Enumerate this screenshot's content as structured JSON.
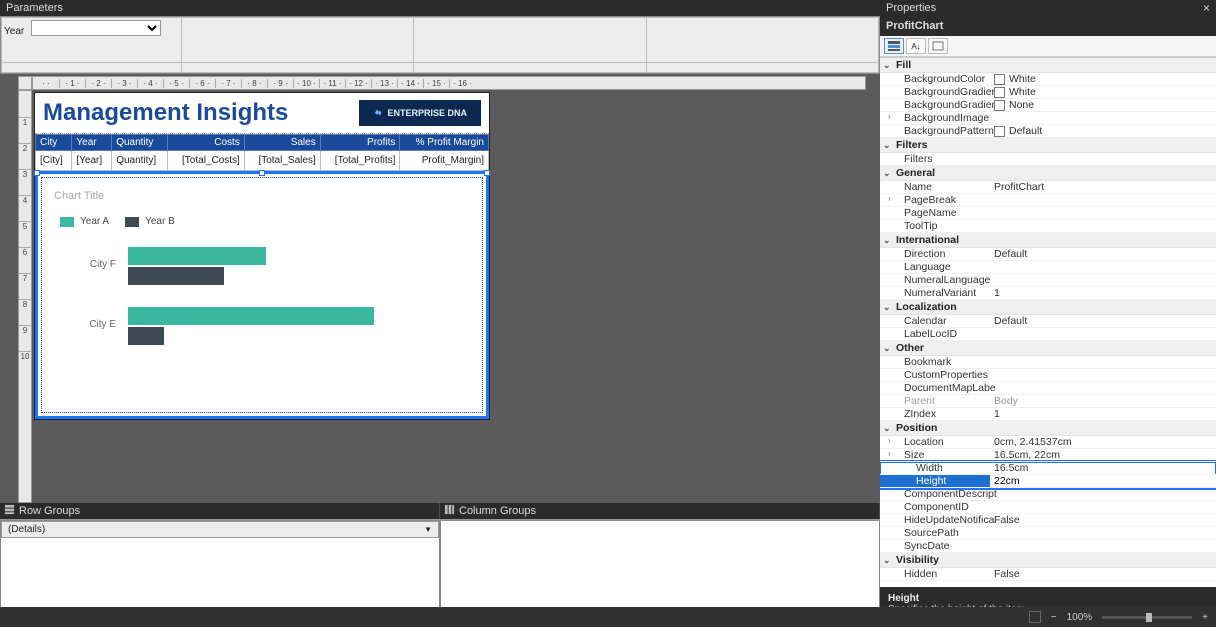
{
  "panels": {
    "parameters_title": "Parameters",
    "properties_title": "Properties",
    "row_groups_title": "Row Groups",
    "column_groups_title": "Column Groups",
    "details_label": "(Details)"
  },
  "params": {
    "year_label": "Year",
    "year_value": ""
  },
  "ruler_h": [
    "",
    "1",
    "2",
    "3",
    "4",
    "5",
    "6",
    "7",
    "8",
    "9",
    "10",
    "11",
    "12",
    "13",
    "14",
    "15",
    "16"
  ],
  "ruler_v": [
    "",
    "1",
    "2",
    "3",
    "4",
    "5",
    "6",
    "7",
    "8",
    "9",
    "10"
  ],
  "report": {
    "title": "Management Insights",
    "logo_text": "ENTERPRISE DNA",
    "columns": [
      "City",
      "Year",
      "Quantity",
      "Costs",
      "Sales",
      "Profits",
      "% Profit Margin"
    ],
    "cells": [
      "[City]",
      "[Year]",
      "Quantity]",
      "[Total_Costs]",
      "[Total_Sales]",
      "[Total_Profits]",
      "Profit_Margin]"
    ]
  },
  "chart": {
    "placeholder_title": "Chart Title",
    "legend_a": "Year A",
    "legend_b": "Year B"
  },
  "chart_data": {
    "type": "bar",
    "orientation": "horizontal",
    "categories": [
      "City F",
      "City E"
    ],
    "series": [
      {
        "name": "Year A",
        "color": "#3ab6a1",
        "values": [
          46,
          82
        ]
      },
      {
        "name": "Year B",
        "color": "#3e4954",
        "values": [
          32,
          12
        ]
      }
    ],
    "title": "Chart Title",
    "xlim": [
      0,
      100
    ]
  },
  "properties": {
    "selected_object": "ProfitChart",
    "groups": [
      {
        "name": "Fill",
        "expanded": true,
        "items": [
          {
            "k": "BackgroundColor",
            "v": "White",
            "color": "#ffffff"
          },
          {
            "k": "BackgroundGradientEndColor",
            "display_k": "BackgroundGradier",
            "v": "White",
            "color": "#ffffff"
          },
          {
            "k": "BackgroundGradientType",
            "display_k": "BackgroundGradier",
            "v": "None",
            "color": "#ffffff"
          },
          {
            "k": "BackgroundImage",
            "v": "",
            "chev": true
          },
          {
            "k": "BackgroundPattern",
            "v": "Default",
            "color": "#ffffff"
          }
        ]
      },
      {
        "name": "Filters",
        "expanded": true,
        "items": [
          {
            "k": "Filters",
            "v": ""
          }
        ]
      },
      {
        "name": "General",
        "expanded": true,
        "items": [
          {
            "k": "Name",
            "v": "ProfitChart"
          },
          {
            "k": "PageBreak",
            "v": "",
            "chev": true
          },
          {
            "k": "PageName",
            "v": ""
          },
          {
            "k": "ToolTip",
            "v": ""
          }
        ]
      },
      {
        "name": "International",
        "expanded": true,
        "items": [
          {
            "k": "Direction",
            "v": "Default"
          },
          {
            "k": "Language",
            "v": ""
          },
          {
            "k": "NumeralLanguage",
            "v": ""
          },
          {
            "k": "NumeralVariant",
            "v": "1"
          }
        ]
      },
      {
        "name": "Localization",
        "expanded": true,
        "items": [
          {
            "k": "Calendar",
            "v": "Default"
          },
          {
            "k": "LabelLocID",
            "v": ""
          }
        ]
      },
      {
        "name": "Other",
        "expanded": true,
        "items": [
          {
            "k": "Bookmark",
            "v": ""
          },
          {
            "k": "CustomProperties",
            "v": ""
          },
          {
            "k": "DocumentMapLabel",
            "display_k": "DocumentMapLabe",
            "v": ""
          },
          {
            "k": "Parent",
            "v": "Body",
            "dim": true
          },
          {
            "k": "ZIndex",
            "v": "1"
          }
        ]
      },
      {
        "name": "Position",
        "expanded": true,
        "items": [
          {
            "k": "Location",
            "v": "0cm, 2.41537cm",
            "chev": true
          },
          {
            "k": "Size",
            "v": "16.5cm, 22cm",
            "chev": true,
            "truncated": true
          },
          {
            "k": "Width",
            "v": "16.5cm",
            "sub": true,
            "highlighted": true
          },
          {
            "k": "Height",
            "v": "22cm",
            "sub": true,
            "highlighted": true,
            "selected": true,
            "editable": true
          }
        ]
      },
      {
        "name": "_postpos",
        "raw": true,
        "items": [
          {
            "k": "ComponentDescription",
            "display_k": "ComponentDescript",
            "v": ""
          },
          {
            "k": "ComponentID",
            "v": ""
          },
          {
            "k": "HideUpdateNotifications",
            "display_k": "HideUpdateNotifica",
            "v": "False"
          },
          {
            "k": "SourcePath",
            "v": ""
          },
          {
            "k": "SyncDate",
            "v": ""
          }
        ]
      },
      {
        "name": "Visibility",
        "expanded": true,
        "items": [
          {
            "k": "Hidden",
            "v": "False"
          }
        ]
      }
    ],
    "desc_title": "Height",
    "desc_body": "Specifies the height of the item."
  },
  "status": {
    "zoom": "100%"
  }
}
